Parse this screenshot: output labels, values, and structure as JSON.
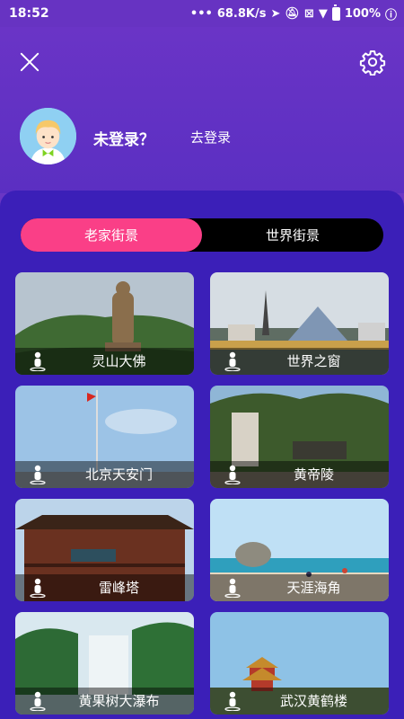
{
  "status_bar": {
    "time": "18:52",
    "network_speed": "68.8K/s",
    "battery": "100%"
  },
  "header": {
    "login_status": "未登录？",
    "login_link": "去登录"
  },
  "tabs": [
    {
      "label": "老家街景",
      "active": true
    },
    {
      "label": "世界街景",
      "active": false
    }
  ],
  "places": [
    {
      "label": "灵山大佛"
    },
    {
      "label": "世界之窗"
    },
    {
      "label": "北京天安门"
    },
    {
      "label": "黄帝陵"
    },
    {
      "label": "雷峰塔"
    },
    {
      "label": "天涯海角"
    },
    {
      "label": "黄果树大瀑布"
    },
    {
      "label": "武汉黄鹤楼"
    }
  ],
  "colors": {
    "header_bg": "#6a34c6",
    "panel_bg": "#3b1fb8",
    "tab_active": "#fa3f87",
    "tab_inactive": "#000000"
  }
}
